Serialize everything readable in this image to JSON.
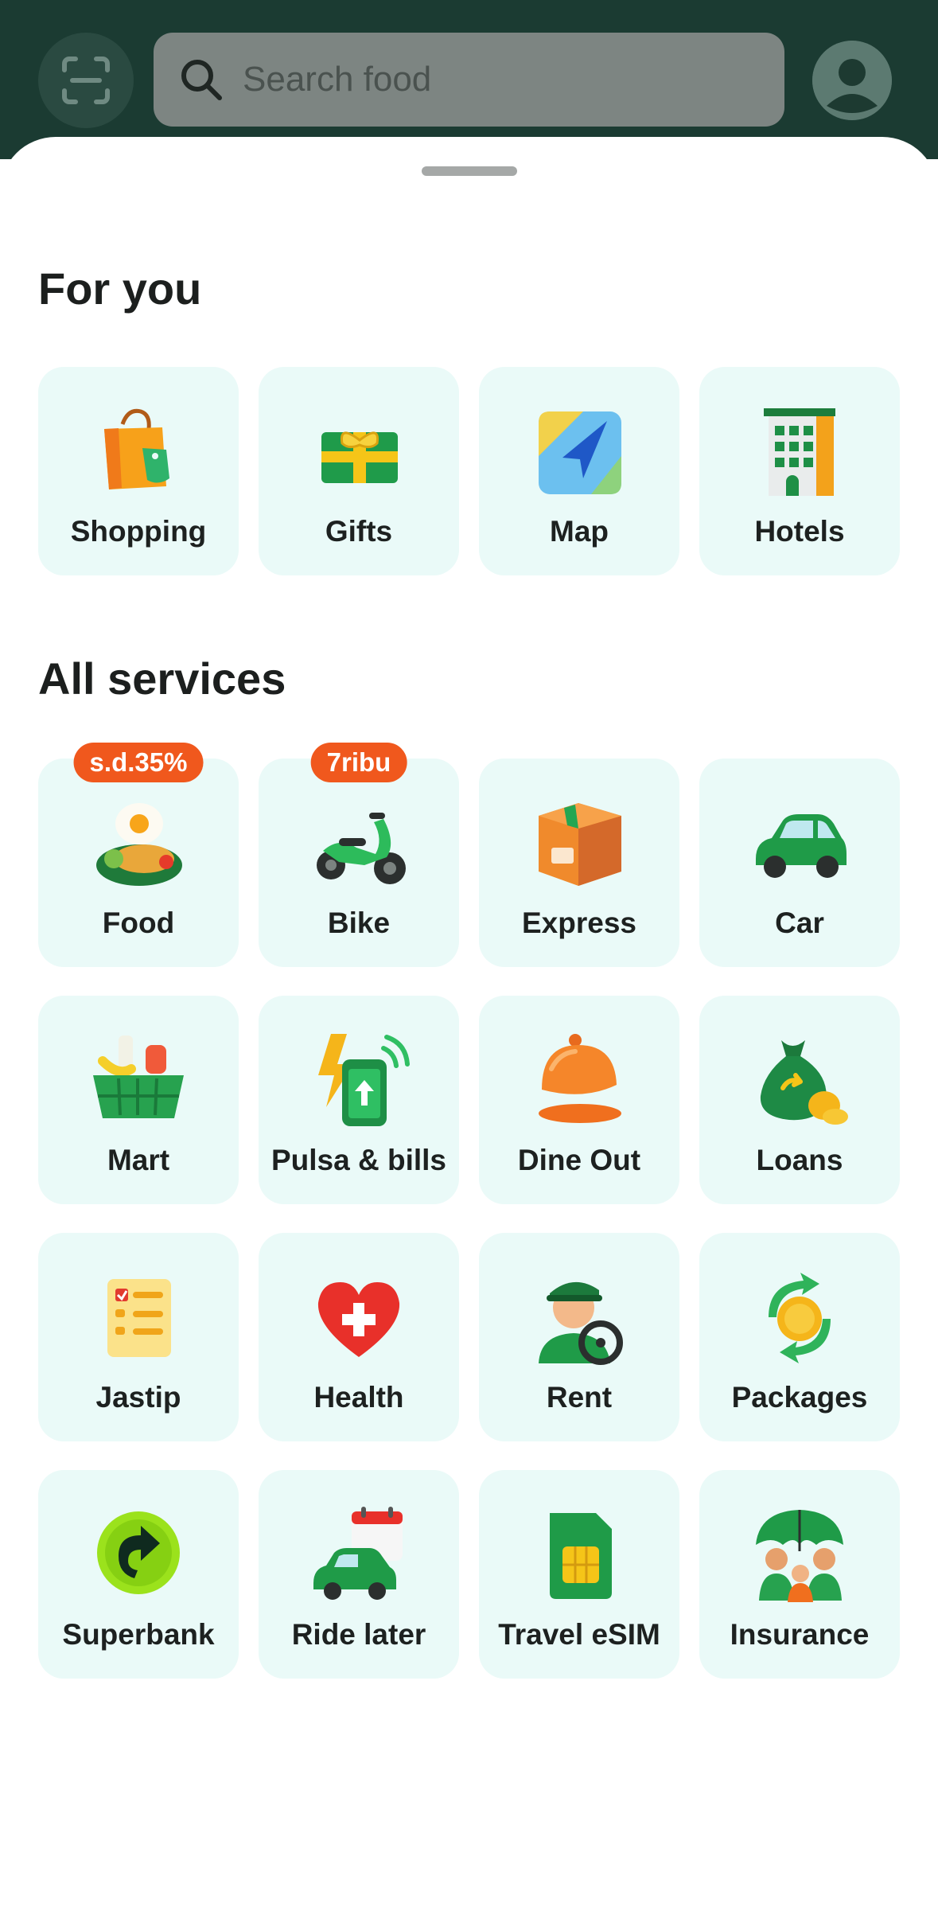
{
  "header": {
    "search_placeholder": "Search food",
    "icons": {
      "scan": "scan-icon",
      "search": "search-icon",
      "profile": "profile-avatar-icon"
    }
  },
  "for_you": {
    "title": "For you",
    "items": [
      {
        "label": "Shopping",
        "icon": "shopping-bag-icon"
      },
      {
        "label": "Gifts",
        "icon": "gift-icon"
      },
      {
        "label": "Map",
        "icon": "map-icon"
      },
      {
        "label": "Hotels",
        "icon": "hotel-icon"
      }
    ]
  },
  "all_services": {
    "title": "All services",
    "items": [
      {
        "label": "Food",
        "icon": "food-icon",
        "badge": "s.d.35%"
      },
      {
        "label": "Bike",
        "icon": "bike-icon",
        "badge": "7ribu"
      },
      {
        "label": "Express",
        "icon": "package-icon"
      },
      {
        "label": "Car",
        "icon": "car-icon"
      },
      {
        "label": "Mart",
        "icon": "grocery-basket-icon"
      },
      {
        "label": "Pulsa & bills",
        "icon": "phone-bolt-icon"
      },
      {
        "label": "Dine Out",
        "icon": "cloche-icon"
      },
      {
        "label": "Loans",
        "icon": "money-bag-icon"
      },
      {
        "label": "Jastip",
        "icon": "checklist-icon"
      },
      {
        "label": "Health",
        "icon": "heart-cross-icon"
      },
      {
        "label": "Rent",
        "icon": "driver-icon"
      },
      {
        "label": "Packages",
        "icon": "coin-cycle-icon"
      },
      {
        "label": "Superbank",
        "icon": "superbank-icon"
      },
      {
        "label": "Ride later",
        "icon": "car-calendar-icon"
      },
      {
        "label": "Travel eSIM",
        "icon": "sim-card-icon"
      },
      {
        "label": "Insurance",
        "icon": "family-umbrella-icon"
      }
    ]
  },
  "colors": {
    "header_bg": "#1b3b32",
    "tile_bg": "#eafaf8",
    "badge_bg": "#f0581d",
    "brand_green": "#00a651"
  }
}
